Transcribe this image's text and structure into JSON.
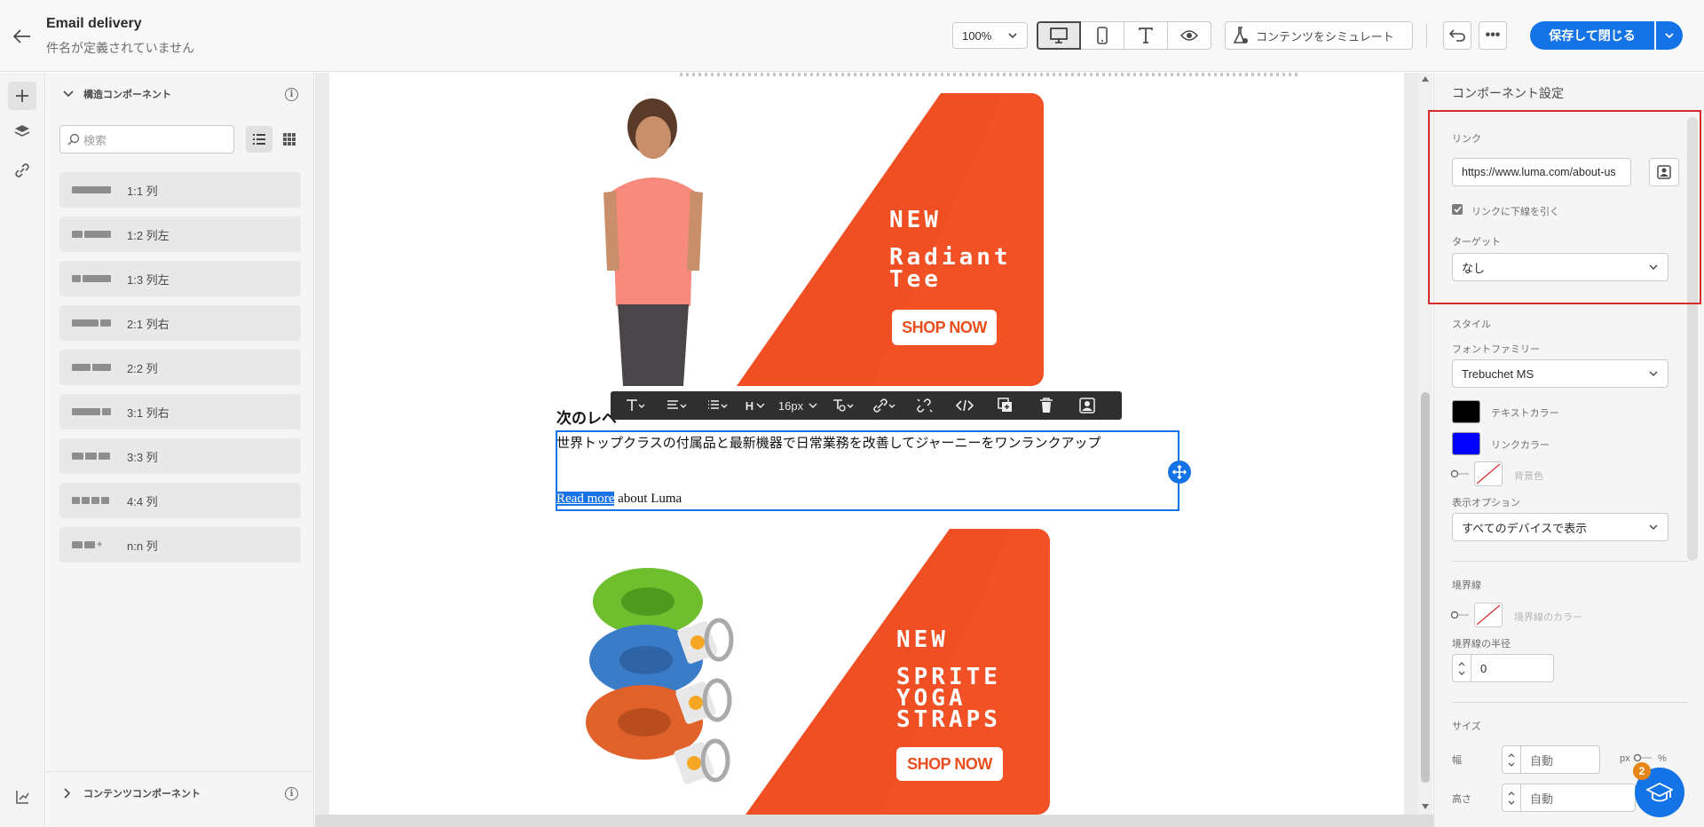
{
  "header": {
    "title": "Email delivery",
    "subtitle": "件名が定義されていません",
    "zoom": "100%",
    "simulate_label": "コンテンツをシミュレート",
    "save_label": "保存して閉じる"
  },
  "left_panel": {
    "structure_title": "構造コンポーネント",
    "search_placeholder": "検索",
    "items": [
      {
        "label": "1:1 列",
        "icon": "one-column"
      },
      {
        "label": "1:2 列左",
        "icon": "two-column-left"
      },
      {
        "label": "1:3 列左",
        "icon": "three-column-left"
      },
      {
        "label": "2:1 列右",
        "icon": "two-column-right"
      },
      {
        "label": "2:2 列",
        "icon": "two-equal-columns"
      },
      {
        "label": "3:1 列右",
        "icon": "three-column-right"
      },
      {
        "label": "3:3 列",
        "icon": "three-columns"
      },
      {
        "label": "4:4 列",
        "icon": "four-columns"
      },
      {
        "label": "n:n 列",
        "icon": "n-columns"
      }
    ],
    "content_title": "コンテンツコンポーネント"
  },
  "canvas": {
    "banner1": {
      "line1": "NEW",
      "line2": "Radiant",
      "line3": "Tee",
      "cta": "SHOP NOW"
    },
    "heading": "次のレベ",
    "body": "世界トップクラスの付属品と最新機器で日常業務を改善してジャーニーをワンランクアップ",
    "link_text": "Read more",
    "link_suffix": " about Luma",
    "banner2": {
      "line1": "NEW",
      "line2": "SPRITE",
      "line3": "YOGA",
      "line4": "STRAPS",
      "cta": "SHOP NOW"
    },
    "toolbar_font_size": "16px",
    "toolbar_heading": "H"
  },
  "settings": {
    "title": "コンポーネント設定",
    "link_label": "リンク",
    "link_value": "https://www.luma.com/about-us",
    "underline_label": "リンクに下線を引く",
    "underline_checked": true,
    "target_label": "ターゲット",
    "target_value": "なし",
    "style_label": "スタイル",
    "font_family_label": "フォントファミリー",
    "font_family_value": "Trebuchet MS",
    "text_color_label": "テキストカラー",
    "text_color": "#000000",
    "link_color_label": "リンクカラー",
    "link_color": "#0000ff",
    "bg_color_label": "背景色",
    "display_label": "表示オプション",
    "display_value": "すべてのデバイスで表示",
    "border_label": "境界線",
    "border_color_label": "境界線のカラー",
    "border_radius_label": "境界線の半径",
    "border_radius_value": "0",
    "size_label": "サイズ",
    "width_label": "幅",
    "width_value": "自動",
    "height_label": "高さ",
    "height_value": "自動",
    "unit_px": "px",
    "unit_pct": "%"
  },
  "help_badge": "2",
  "colors": {
    "accent": "#1473e6",
    "banner": "#f04e23",
    "highlight": "#d92b2b"
  }
}
